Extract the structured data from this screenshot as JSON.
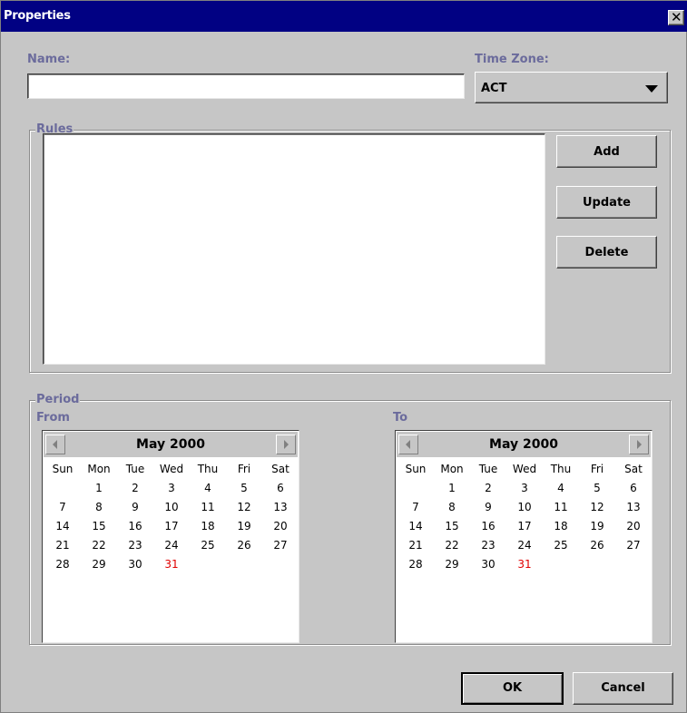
{
  "window": {
    "title": "Properties",
    "close_glyph": "✕"
  },
  "name_field": {
    "label": "Name:",
    "value": ""
  },
  "timezone": {
    "label": "Time Zone:",
    "selected": "ACT"
  },
  "rules": {
    "title": "Rules",
    "buttons": {
      "add": "Add",
      "update": "Update",
      "delete": "Delete"
    }
  },
  "period": {
    "title": "Period",
    "from": {
      "label": "From",
      "month": "May 2000",
      "weekdays": [
        "Sun",
        "Mon",
        "Tue",
        "Wed",
        "Thu",
        "Fri",
        "Sat"
      ],
      "weeks": [
        [
          "",
          "1",
          "2",
          "3",
          "4",
          "5",
          "6"
        ],
        [
          "7",
          "8",
          "9",
          "10",
          "11",
          "12",
          "13"
        ],
        [
          "14",
          "15",
          "16",
          "17",
          "18",
          "19",
          "20"
        ],
        [
          "21",
          "22",
          "23",
          "24",
          "25",
          "26",
          "27"
        ],
        [
          "28",
          "29",
          "30",
          "31",
          "",
          "",
          ""
        ]
      ],
      "highlight_day": "31"
    },
    "to": {
      "label": "To",
      "month": "May 2000",
      "weekdays": [
        "Sun",
        "Mon",
        "Tue",
        "Wed",
        "Thu",
        "Fri",
        "Sat"
      ],
      "weeks": [
        [
          "",
          "1",
          "2",
          "3",
          "4",
          "5",
          "6"
        ],
        [
          "7",
          "8",
          "9",
          "10",
          "11",
          "12",
          "13"
        ],
        [
          "14",
          "15",
          "16",
          "17",
          "18",
          "19",
          "20"
        ],
        [
          "21",
          "22",
          "23",
          "24",
          "25",
          "26",
          "27"
        ],
        [
          "28",
          "29",
          "30",
          "31",
          "",
          "",
          ""
        ]
      ],
      "highlight_day": "31"
    }
  },
  "footer": {
    "ok": "OK",
    "cancel": "Cancel"
  },
  "colors": {
    "titlebar": "#010183",
    "label": "#6b6b9c",
    "highlight": "#e00000",
    "face": "#c6c6c6"
  }
}
